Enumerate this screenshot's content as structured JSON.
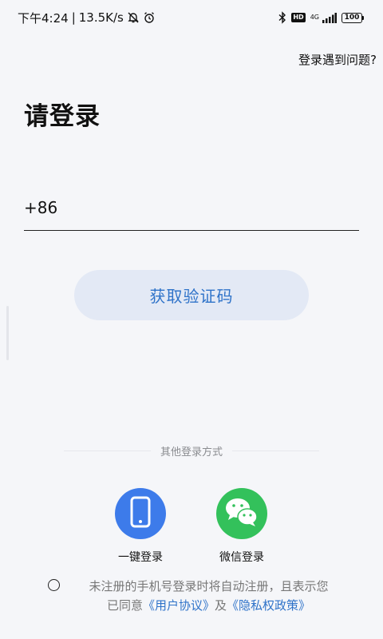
{
  "status_bar": {
    "time": "下午4:24",
    "separator": "|",
    "net_speed": "13.5K/s",
    "hd": "HD",
    "network": "4G",
    "battery": "100"
  },
  "header": {
    "help_link": "登录遇到问题?",
    "title": "请登录"
  },
  "phone": {
    "country_code": "+86",
    "value": "",
    "placeholder": ""
  },
  "primary_button": {
    "label": "获取验证码"
  },
  "alt_login": {
    "divider_label": "其他登录方式",
    "items": [
      {
        "label": "一键登录",
        "icon": "phone-icon",
        "color": "#3d7bea"
      },
      {
        "label": "微信登录",
        "icon": "wechat-icon",
        "color": "#33c15b"
      }
    ]
  },
  "agreement": {
    "text_line1": "未注册的手机号登录时将自动注册，且表示您",
    "text_agreed": "已同意",
    "user_agreement": "《用户协议》",
    "and": "及",
    "privacy_policy": "《隐私权政策》"
  },
  "colors": {
    "accent": "#2f73c9",
    "button_bg": "#e3e9f5",
    "background": "#f5f6f9"
  }
}
